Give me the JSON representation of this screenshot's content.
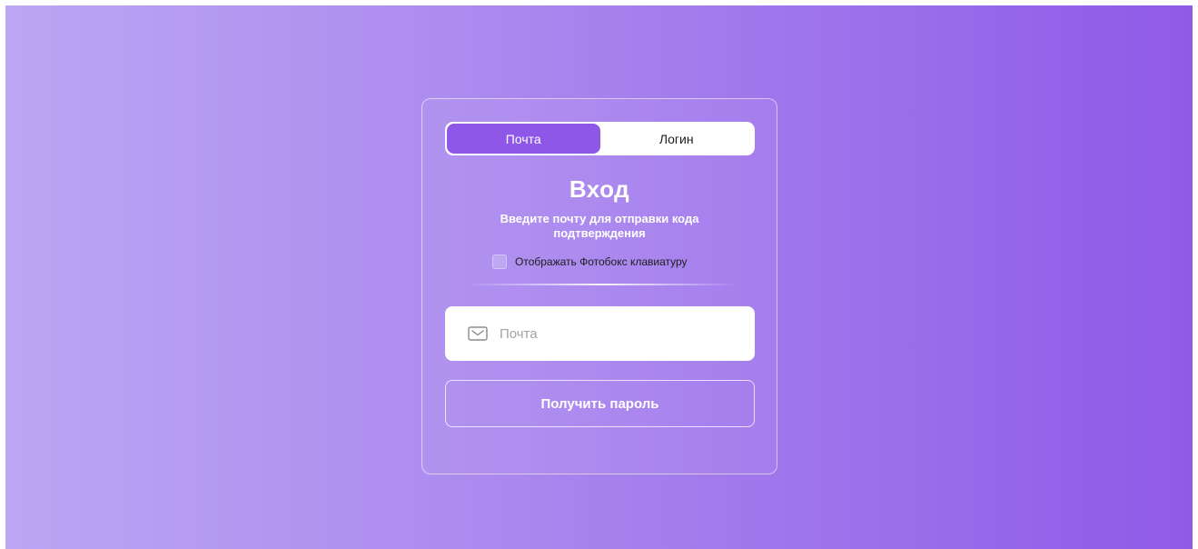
{
  "colors": {
    "accent": "#8e57e8",
    "background_left": "#bca6f3",
    "background_right": "#8f5ae8"
  },
  "tabs": [
    {
      "label": "Почта",
      "active": true
    },
    {
      "label": "Логин",
      "active": false
    }
  ],
  "login": {
    "title": "Вход",
    "subtitle": "Введите почту для отправки кода подтверждения",
    "keyboard_option": {
      "label": "Отображать Фотобокс клавиатуру",
      "checked": false
    },
    "email_input": {
      "value": "",
      "placeholder": "Почта",
      "icon": "mail-icon"
    },
    "submit_label": "Получить пароль"
  }
}
